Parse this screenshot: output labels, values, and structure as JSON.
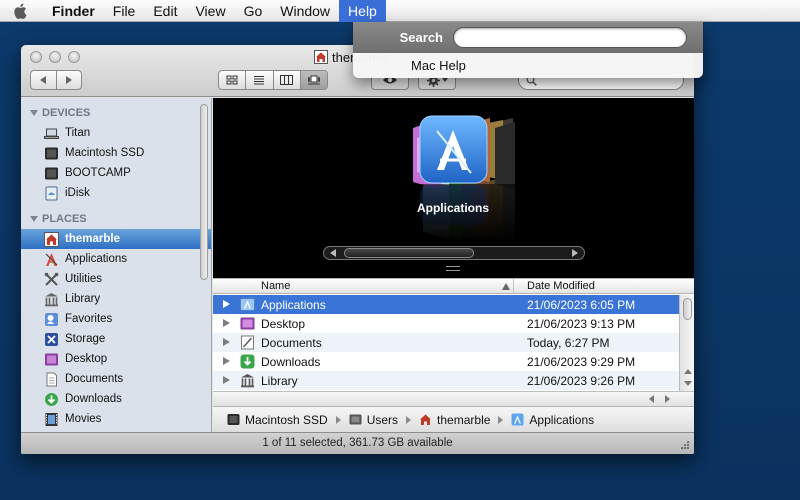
{
  "menubar": {
    "app_name": "Finder",
    "items": [
      {
        "label": "File"
      },
      {
        "label": "Edit"
      },
      {
        "label": "View"
      },
      {
        "label": "Go"
      },
      {
        "label": "Window"
      },
      {
        "label": "Help"
      }
    ],
    "active_item": "Help"
  },
  "help_menu": {
    "search_label": "Search",
    "search_value": "",
    "items": [
      {
        "label": "Mac Help"
      }
    ]
  },
  "window": {
    "title": "themarble",
    "search_value": ""
  },
  "sidebar": {
    "devices_header": "DEVICES",
    "devices": [
      {
        "label": "Titan",
        "icon": "laptop-icon"
      },
      {
        "label": "Macintosh SSD",
        "icon": "drive-icon"
      },
      {
        "label": "BOOTCAMP",
        "icon": "drive-icon"
      },
      {
        "label": "iDisk",
        "icon": "idisk-icon"
      }
    ],
    "places_header": "PLACES",
    "places": [
      {
        "label": "themarble",
        "icon": "home-icon",
        "selected": true
      },
      {
        "label": "Applications",
        "icon": "applications-icon"
      },
      {
        "label": "Utilities",
        "icon": "utilities-icon"
      },
      {
        "label": "Library",
        "icon": "library-icon"
      },
      {
        "label": "Favorites",
        "icon": "favorites-icon"
      },
      {
        "label": "Storage",
        "icon": "storage-icon"
      },
      {
        "label": "Desktop",
        "icon": "desktop-icon"
      },
      {
        "label": "Documents",
        "icon": "documents-icon"
      },
      {
        "label": "Downloads",
        "icon": "downloads-icon"
      },
      {
        "label": "Movies",
        "icon": "movies-icon"
      }
    ]
  },
  "coverflow": {
    "selected_label": "Applications"
  },
  "file_list": {
    "columns": {
      "name": "Name",
      "date": "Date Modified"
    },
    "rows": [
      {
        "name": "Applications",
        "date": "21/06/2023 6:05 PM",
        "icon": "applications-folder-icon",
        "selected": true
      },
      {
        "name": "Desktop",
        "date": "21/06/2023 9:13 PM",
        "icon": "desktop-folder-icon"
      },
      {
        "name": "Documents",
        "date": "Today, 6:27 PM",
        "icon": "documents-folder-icon"
      },
      {
        "name": "Downloads",
        "date": "21/06/2023 9:29 PM",
        "icon": "downloads-folder-icon"
      },
      {
        "name": "Library",
        "date": "21/06/2023 9:26 PM",
        "icon": "library-folder-icon"
      }
    ]
  },
  "path_bar": {
    "segments": [
      {
        "label": "Macintosh SSD",
        "icon": "drive-icon"
      },
      {
        "label": "Users",
        "icon": "folder-icon"
      },
      {
        "label": "themarble",
        "icon": "home-icon"
      },
      {
        "label": "Applications",
        "icon": "applications-icon"
      }
    ]
  },
  "status_bar": {
    "text": "1 of 11 selected, 361.73 GB available"
  },
  "colors": {
    "desktop": "#0b3462",
    "selection": "#3a74d7",
    "sidebar": "#dbe1ea"
  }
}
